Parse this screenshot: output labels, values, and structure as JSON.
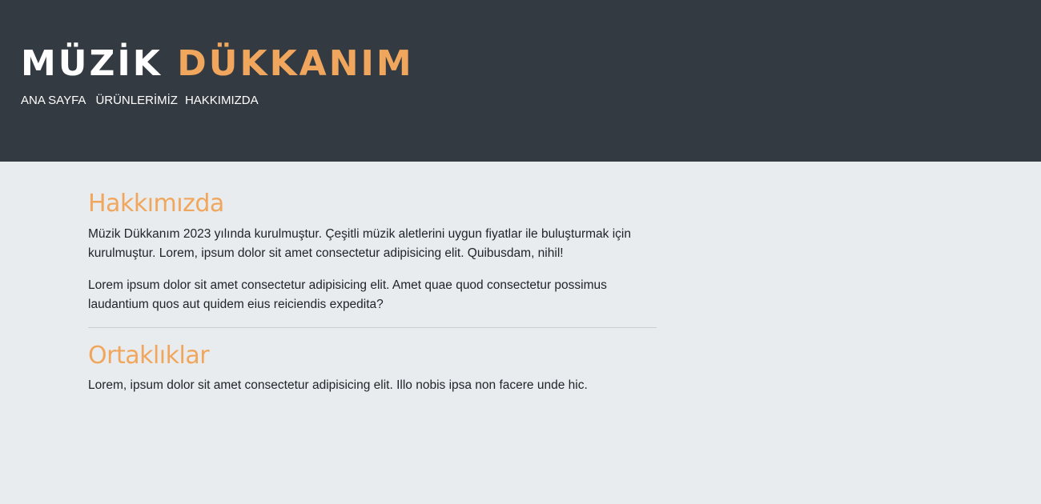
{
  "header": {
    "logo_white": "MÜZİK",
    "logo_orange": "DÜKKANIM",
    "nav": [
      {
        "label": "ANA SAYFA"
      },
      {
        "label": "ÜRÜNLERİMİZ"
      },
      {
        "label": "HAKKIMIZDA"
      }
    ]
  },
  "about": {
    "title": "Hakkımızda",
    "paragraph1": "Müzik Dükkanım 2023 yılında kurulmuştur. Çeşitli müzik aletlerini uygun fiyatlar ile buluşturmak için kurulmuştur. Lorem, ipsum dolor sit amet consectetur adipisicing elit. Quibusdam, nihil!",
    "paragraph2": "Lorem ipsum dolor sit amet consectetur adipisicing elit. Amet quae quod consectetur possimus laudantium quos aut quidem eius reiciendis expedita?"
  },
  "partners": {
    "title": "Ortaklıklar",
    "paragraph": "Lorem, ipsum dolor sit amet consectetur adipisicing elit. Illo nobis ipsa non facere unde hic."
  },
  "colors": {
    "header_bg": "#343a41",
    "accent": "#f0a75d",
    "page_bg": "#e9ecef",
    "text": "#212529"
  }
}
